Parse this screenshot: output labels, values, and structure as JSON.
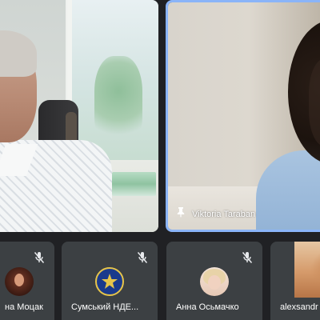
{
  "main_tiles": [
    {
      "name": ""
    },
    {
      "name": "Viktoria Taraban"
    }
  ],
  "participants": [
    {
      "name": "на Моцак",
      "muted": true
    },
    {
      "name": "Сумський НДЕ...",
      "muted": true
    },
    {
      "name": "Анна Осьмачко",
      "muted": true
    },
    {
      "name": "alexsandr",
      "muted": false
    }
  ],
  "icons": {
    "pin": "pin-icon",
    "muted": "mic-off-icon"
  },
  "colors": {
    "background": "#202124",
    "tile": "#3c4043",
    "active_speaker_border": "#8ab4f8",
    "text": "#ffffff"
  }
}
